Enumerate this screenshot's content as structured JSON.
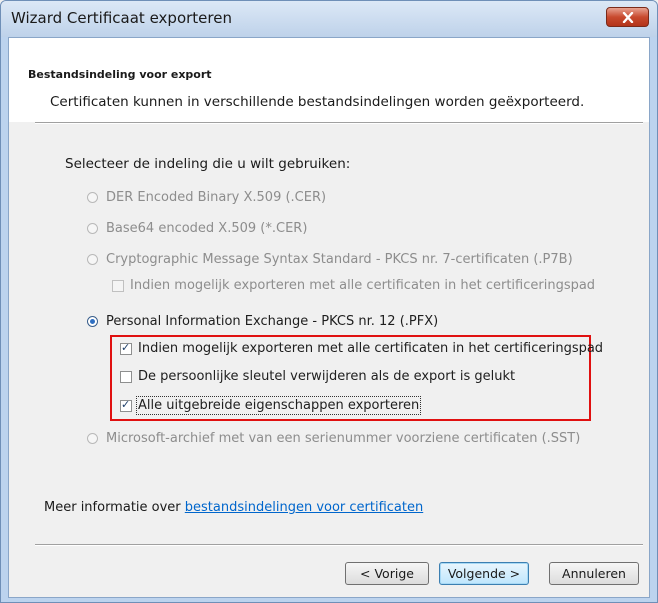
{
  "window": {
    "title": "Wizard Certificaat exporteren",
    "close_label": "Sluiten"
  },
  "header": {
    "title": "Bestandsindeling voor export",
    "description": "Certificaten kunnen in verschillende bestandsindelingen worden geëxporteerd."
  },
  "instruction": "Selecteer de indeling die u wilt gebruiken:",
  "options": {
    "der": {
      "label": "DER Encoded Binary X.509 (.CER)",
      "selected": false,
      "enabled": false
    },
    "base64": {
      "label": "Base64 encoded X.509 (*.CER)",
      "selected": false,
      "enabled": false
    },
    "pkcs7": {
      "label": "Cryptographic Message Syntax Standard - PKCS nr. 7-certificaten (.P7B)",
      "selected": false,
      "enabled": false
    },
    "pkcs7_include_path": {
      "label": "Indien mogelijk exporteren met alle certificaten in het certificeringspad",
      "checked": false,
      "enabled": false
    },
    "pfx": {
      "label": "Personal Information Exchange - PKCS nr. 12 (.PFX)",
      "selected": true,
      "enabled": true
    },
    "pfx_include_path": {
      "label": "Indien mogelijk exporteren met alle certificaten in het certificeringspad",
      "checked": true,
      "enabled": true
    },
    "pfx_delete_key": {
      "label": "De persoonlijke sleutel verwijderen als de export is gelukt",
      "checked": false,
      "enabled": true
    },
    "pfx_export_props": {
      "label": "Alle uitgebreide eigenschappen exporteren",
      "checked": true,
      "enabled": true
    },
    "sst": {
      "label": "Microsoft-archief met van een serienummer voorziene certificaten (.SST)",
      "selected": false,
      "enabled": false
    }
  },
  "more_info": {
    "prefix": "Meer informatie over ",
    "link": "bestandsindelingen voor certificaten"
  },
  "buttons": {
    "back": "< Vorige",
    "next": "Volgende >",
    "cancel": "Annuleren"
  },
  "colors": {
    "highlight": "#e01010",
    "link": "#0066cc",
    "titlebar": "#bed2ea"
  }
}
